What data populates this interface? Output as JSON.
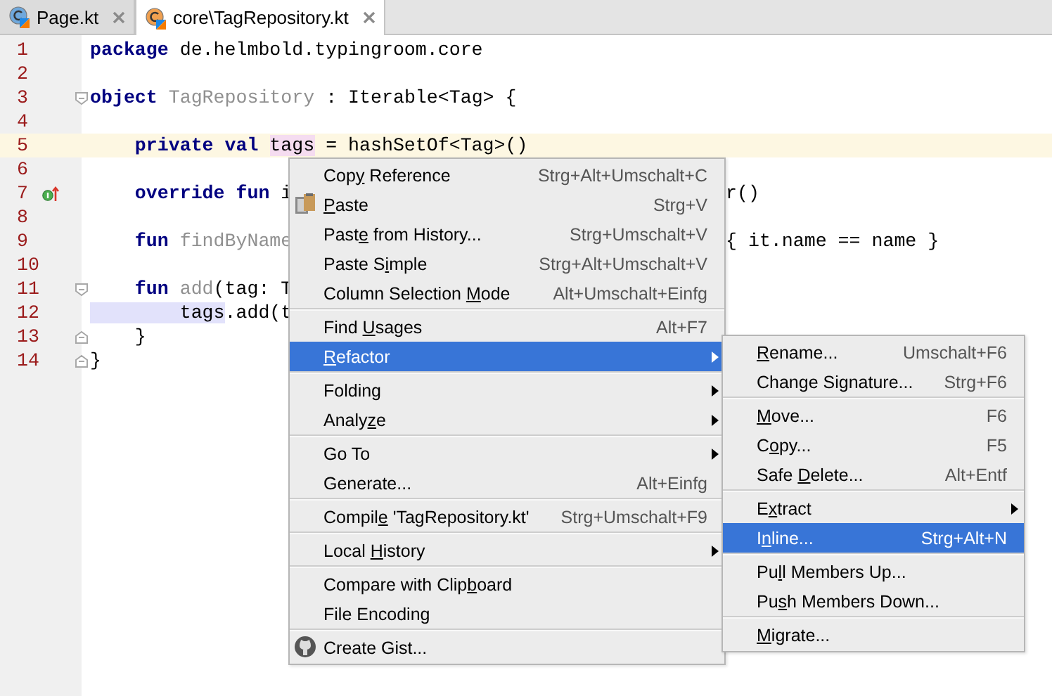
{
  "tabs": [
    {
      "label": "Page.kt",
      "kind": "class",
      "selected": false
    },
    {
      "label": "core\\TagRepository.kt",
      "kind": "object",
      "selected": true
    }
  ],
  "editor": {
    "lines": [
      {
        "number": "1",
        "current": false,
        "tokens": [
          {
            "kind": "keyword",
            "text": "package"
          },
          {
            "kind": "plain",
            "text": " de.helmbold.typingroom.core"
          }
        ]
      },
      {
        "number": "2",
        "current": false
      },
      {
        "number": "3",
        "current": false,
        "fold_start": true,
        "tokens": [
          {
            "kind": "keyword",
            "text": "object"
          },
          {
            "kind": "dim",
            "text": " TagRepository"
          },
          {
            "kind": "plain",
            "text": " : Iterable<Tag> {"
          }
        ]
      },
      {
        "number": "4",
        "current": false
      },
      {
        "number": "5",
        "current": true,
        "tokens": [
          {
            "kind": "keyword",
            "text": "    private val "
          },
          {
            "kind": "write",
            "text": "tags"
          },
          {
            "kind": "plain",
            "text": " = hashSetOf<Tag>()"
          }
        ]
      },
      {
        "number": "6",
        "current": false
      },
      {
        "number": "7",
        "current": false,
        "implements": true,
        "tokens": [
          {
            "kind": "keyword",
            "text": "    override fun"
          },
          {
            "kind": "plain",
            "text": " i"
          }
        ],
        "tail": "r()"
      },
      {
        "number": "8",
        "current": false
      },
      {
        "number": "9",
        "current": false,
        "tokens": [
          {
            "kind": "keyword",
            "text": "    fun"
          },
          {
            "kind": "dim",
            "text": " findByName"
          }
        ],
        "tail": "{ it.name == name }"
      },
      {
        "number": "10",
        "current": false
      },
      {
        "number": "11",
        "current": false,
        "fold_start": true,
        "tokens": [
          {
            "kind": "keyword",
            "text": "    fun"
          },
          {
            "kind": "dim",
            "text": " add"
          },
          {
            "kind": "plain",
            "text": "(tag: T"
          }
        ]
      },
      {
        "number": "12",
        "current": false,
        "tokens": [
          {
            "kind": "read",
            "text": "        tags"
          },
          {
            "kind": "plain",
            "text": ".add(t"
          }
        ]
      },
      {
        "number": "13",
        "current": false,
        "fold_end": true,
        "tokens": [
          {
            "kind": "plain",
            "text": "    }"
          }
        ]
      },
      {
        "number": "14",
        "current": false,
        "fold_end": true,
        "tokens": [
          {
            "kind": "plain",
            "text": "}"
          }
        ]
      }
    ]
  },
  "context_menu": {
    "items": [
      {
        "kind": "item",
        "before": "Cop",
        "mnemonic": "y",
        "after": " Reference",
        "shortcut": "Strg+Alt+Umschalt+C",
        "submenu": false,
        "selected": false
      },
      {
        "kind": "paste",
        "mnemonic": "P",
        "after": "aste",
        "shortcut": "Strg+V",
        "submenu": false,
        "selected": false
      },
      {
        "kind": "item",
        "before": "Past",
        "mnemonic": "e",
        "after": " from History...",
        "shortcut": "Strg+Umschalt+V",
        "submenu": false,
        "selected": false
      },
      {
        "kind": "item",
        "before": "Paste S",
        "mnemonic": "i",
        "after": "mple",
        "shortcut": "Strg+Alt+Umschalt+V",
        "submenu": false,
        "selected": false
      },
      {
        "kind": "item",
        "before": "Column Selection ",
        "mnemonic": "M",
        "after": "ode",
        "shortcut": "Alt+Umschalt+Einfg",
        "submenu": false,
        "selected": false
      },
      {
        "kind": "separator"
      },
      {
        "kind": "item",
        "before": "Find ",
        "mnemonic": "U",
        "after": "sages",
        "shortcut": "Alt+F7",
        "submenu": false,
        "selected": false
      },
      {
        "kind": "item",
        "mnemonic": "R",
        "after": "efactor",
        "submenu": true,
        "selected": true
      },
      {
        "kind": "separator"
      },
      {
        "kind": "item",
        "before": "Folding",
        "submenu": true,
        "selected": false
      },
      {
        "kind": "item",
        "before": "Analy",
        "mnemonic": "z",
        "after": "e",
        "submenu": true,
        "selected": false
      },
      {
        "kind": "separator"
      },
      {
        "kind": "item",
        "before": "Go To",
        "submenu": true,
        "selected": false
      },
      {
        "kind": "item",
        "before": "Generate...",
        "shortcut": "Alt+Einfg",
        "submenu": false,
        "selected": false
      },
      {
        "kind": "separator"
      },
      {
        "kind": "item",
        "before": "Compil",
        "mnemonic": "e",
        "after": " 'TagRepository.kt'",
        "shortcut": "Strg+Umschalt+F9",
        "submenu": false,
        "selected": false
      },
      {
        "kind": "separator"
      },
      {
        "kind": "item",
        "before": "Local ",
        "mnemonic": "H",
        "after": "istory",
        "submenu": true,
        "selected": false
      },
      {
        "kind": "separator"
      },
      {
        "kind": "item",
        "before": "Compare with Clip",
        "mnemonic": "b",
        "after": "oard",
        "submenu": false,
        "selected": false
      },
      {
        "kind": "item",
        "before": "File Encoding",
        "submenu": false,
        "selected": false
      },
      {
        "kind": "separator"
      },
      {
        "kind": "gist",
        "before": "Create Gist...",
        "submenu": false,
        "selected": false
      }
    ]
  },
  "submenu": {
    "items": [
      {
        "kind": "item",
        "mnemonic": "R",
        "after": "ename...",
        "shortcut": "Umschalt+F6",
        "submenu": false,
        "selected": false
      },
      {
        "kind": "item",
        "before": "Change Si",
        "mnemonic": "g",
        "after": "nature...",
        "shortcut": "Strg+F6",
        "submenu": false,
        "selected": false
      },
      {
        "kind": "separator"
      },
      {
        "kind": "item",
        "mnemonic": "M",
        "after": "ove...",
        "shortcut": "F6",
        "submenu": false,
        "selected": false
      },
      {
        "kind": "item",
        "before": "C",
        "mnemonic": "o",
        "after": "py...",
        "shortcut": "F5",
        "submenu": false,
        "selected": false
      },
      {
        "kind": "item",
        "before": "Safe ",
        "mnemonic": "D",
        "after": "elete...",
        "shortcut": "Alt+Entf",
        "submenu": false,
        "selected": false
      },
      {
        "kind": "separator"
      },
      {
        "kind": "item",
        "before": "E",
        "mnemonic": "x",
        "after": "tract",
        "submenu": true,
        "selected": false
      },
      {
        "kind": "item",
        "before": "I",
        "mnemonic": "n",
        "after": "line...",
        "shortcut": "Strg+Alt+N",
        "submenu": false,
        "selected": true
      },
      {
        "kind": "separator"
      },
      {
        "kind": "item",
        "before": "Pu",
        "mnemonic": "l",
        "after": "l Members Up...",
        "submenu": false,
        "selected": false
      },
      {
        "kind": "item",
        "before": "Pu",
        "mnemonic": "s",
        "after": "h Members Down...",
        "submenu": false,
        "selected": false
      },
      {
        "kind": "separator"
      },
      {
        "kind": "item",
        "mnemonic": "M",
        "after": "igrate...",
        "submenu": false,
        "selected": false
      }
    ]
  }
}
